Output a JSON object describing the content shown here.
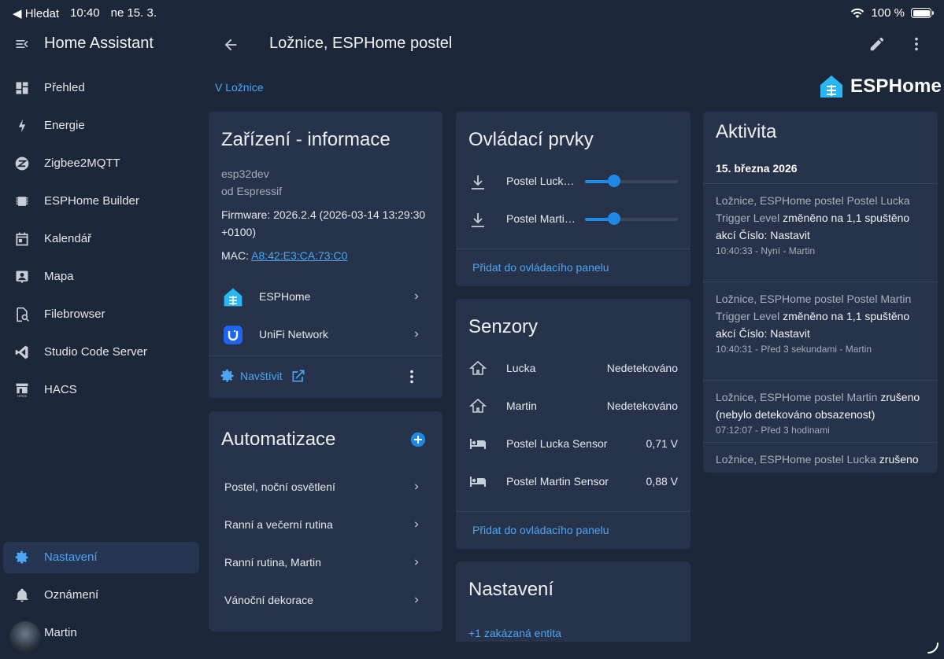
{
  "status_bar": {
    "back_app": "Hledat",
    "time": "10:40",
    "date": "ne 15. 3.",
    "battery": "100 %"
  },
  "sidebar": {
    "title": "Home Assistant",
    "items": [
      {
        "label": "Přehled",
        "icon": "dashboard-icon"
      },
      {
        "label": "Energie",
        "icon": "lightning-icon"
      },
      {
        "label": "Zigbee2MQTT",
        "icon": "zigbee-icon"
      },
      {
        "label": "ESPHome Builder",
        "icon": "chip-icon"
      },
      {
        "label": "Kalendář",
        "icon": "calendar-icon"
      },
      {
        "label": "Mapa",
        "icon": "map-account-icon"
      },
      {
        "label": "Filebrowser",
        "icon": "file-search-icon"
      },
      {
        "label": "Studio Code Server",
        "icon": "vscode-icon"
      },
      {
        "label": "HACS",
        "icon": "hacs-icon"
      }
    ],
    "settings_label": "Nastavení",
    "notifications_label": "Oznámení",
    "user_label": "Martin"
  },
  "topbar": {
    "title": "Ložnice, ESPHome postel"
  },
  "breadcrumb": "V Ložnice",
  "brand": {
    "text": "ESPHome"
  },
  "device_info": {
    "title": "Zařízení - informace",
    "model": "esp32dev",
    "manufacturer": "od Espressif",
    "firmware_line1": "Firmware: 2026.2.4 (2026-03-14 13:29:30",
    "firmware_line2": "+0100)",
    "mac_label": "MAC:",
    "mac_value": "A8:42:E3:CA:73:C0",
    "integrations": [
      {
        "label": "ESPHome"
      },
      {
        "label": "UniFi Network"
      }
    ],
    "visit_label": "Navštívit"
  },
  "automations": {
    "title": "Automatizace",
    "items": [
      "Postel, noční osvětlení",
      "Ranní a večerní rutina",
      "Ranní rutina, Martin",
      "Vánoční dekorace"
    ]
  },
  "controls": {
    "title": "Ovládací prvky",
    "items": [
      {
        "label": "Postel Lucka Trigger Level",
        "level": 0.31
      },
      {
        "label": "Postel Martin Trigger Level",
        "level": 0.31
      }
    ],
    "add_label": "Přidat do ovládacího panelu"
  },
  "sensors": {
    "title": "Senzory",
    "items": [
      {
        "label": "Lucka",
        "value": "Nedetekováno",
        "icon": "home-outline-icon"
      },
      {
        "label": "Martin",
        "value": "Nedetekováno",
        "icon": "home-outline-icon"
      },
      {
        "label": "Postel Lucka Sensor",
        "value": "0,71 V",
        "icon": "bed-icon"
      },
      {
        "label": "Postel Martin Sensor",
        "value": "0,88 V",
        "icon": "bed-icon"
      }
    ],
    "add_label": "Přidat do ovládacího panelu"
  },
  "settings_card": {
    "title": "Nastavení",
    "disabled_link": "+1 zakázaná entita"
  },
  "activity": {
    "title": "Aktivita",
    "date": "15. března 2026",
    "entries": [
      {
        "subject": "Ložnice, ESPHome postel Postel Lucka Trigger Level",
        "action": "změněno na 1,1 spuštěno akcí Číslo: Nastavit",
        "meta": "10:40:33 - Nyní - Martin"
      },
      {
        "subject": "Ložnice, ESPHome postel Postel Martin Trigger Level",
        "action": "změněno na 1,1 spuštěno akcí Číslo: Nastavit",
        "meta": "10:40:31 - Před 3 sekundami - Martin"
      },
      {
        "subject": "Ložnice, ESPHome postel Martin",
        "action": "zrušeno (nebylo detekováno obsazenost)",
        "meta": "07:12:07 - Před 3 hodinami"
      },
      {
        "subject": "Ložnice, ESPHome postel Lucka",
        "action": "zrušeno",
        "meta": ""
      }
    ]
  },
  "colors": {
    "background": "#1c2739",
    "card": "#27334a",
    "accent": "#4aa6f4",
    "slider": "#1e88e5"
  }
}
